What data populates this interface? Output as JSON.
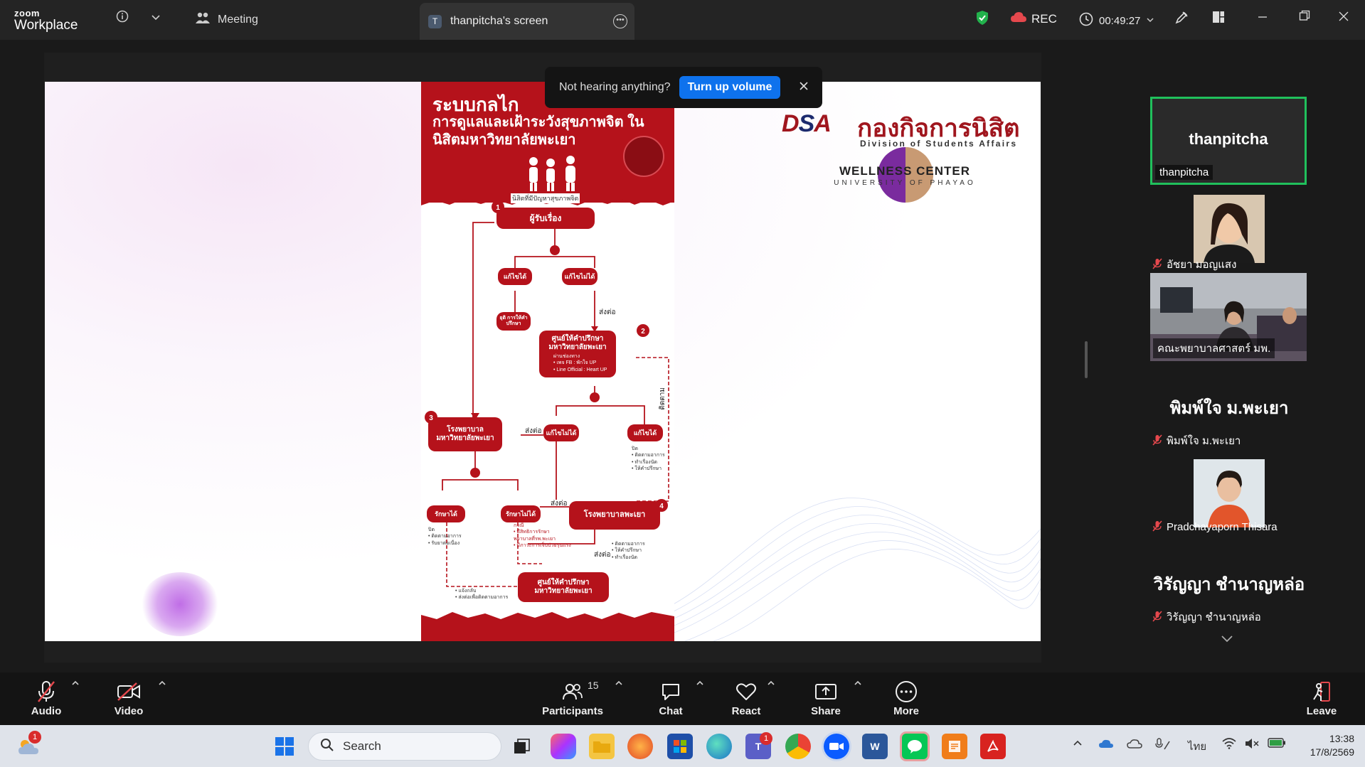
{
  "titlebar": {
    "logo_small": "zoom",
    "logo_big": "Workplace",
    "meeting_label": "Meeting",
    "shared_screen_tab": "thanpitcha's screen",
    "shared_screen_initial": "T",
    "rec_label": "REC",
    "elapsed_time": "00:49:27"
  },
  "toast": {
    "message": "Not hearing anything?",
    "button_label": "Turn up volume"
  },
  "poster": {
    "title_line1": "ระบบกลไก",
    "title_line2": "การดูแลและเฝ้าระวังสุขภาพจิต ในนิสิตมหาวิทยาลัยพะเยา",
    "caption": "นิสิตที่มีปัญหาสุขภาพจิต",
    "nodes": {
      "receiver": "ผู้รับเรื่อง",
      "solved1": "แก้ไขได้",
      "unsolved1": "แก้ไขไม่ได้",
      "close_case1": "ยุติ การให้คำปรึกษา",
      "counsel_center1": "ศูนย์ให้คำปรึกษา มหาวิทยาลัยพะเยา",
      "uni_hospital": "โรงพยาบาล มหาวิทยาลัยพะเยา",
      "unsolved2": "แก้ไขไม่ได้",
      "solved2": "แก้ไขได้",
      "treat_ok": "รักษาได้",
      "treat_fail": "รักษาไม่ได้",
      "phayao_hospital": "โรงพยาบาลพะเยา",
      "counsel_center2": "ศูนย์ให้คำปรึกษา มหาวิทยาลัยพะเยา"
    },
    "flow_labels": {
      "forward1": "ส่งต่อ",
      "forward2": "ส่งต่อ",
      "forward3": "ส่งต่อ",
      "forward4": "ส่งต่อ",
      "follow": "ติดตาม"
    },
    "counsel_bullets": [
      "ผ่านช่องทาง",
      "• เพจ FB : พักใจ UP",
      "• Line Official : Heart UP"
    ],
    "solved2_bullets": [
      "ปิด",
      "• ติดตามอาการ",
      "• ทำเรื่องนัด",
      "• ให้คำปรึกษา"
    ],
    "treat_ok_bullets": [
      "ปิด",
      "• ติดตามอาการ",
      "• รับยาต่อเนื่อง"
    ],
    "treat_fail_bullets": [
      "กรณี",
      "• มีสิทธิการรักษา",
      "  พยาบาลที่รพ.พะเยา",
      "• มีภาวะการเจ็บป่วยรุนแรง"
    ],
    "phayao_bullets": [
      "• ติดตามอาการ",
      "• ให้คำปรึกษา",
      "• ทำเรื่องนัด"
    ],
    "counsel2_bullets": [
      "• แจ้งกลับ",
      "• ส่งต่อเพื่อติดตามอาการ"
    ],
    "step_numbers": [
      "1",
      "2",
      "3",
      "4"
    ]
  },
  "logos": {
    "dsa_mark_d": "D",
    "dsa_mark_s": "S",
    "dsa_mark_a": "A",
    "dsa_thai": "กองกิจการนิสิต",
    "dsa_english": "Division of Students Affairs",
    "wellness_title": "WELLNESS CENTER",
    "wellness_sub": "UNIVERSITY OF PHAYAO"
  },
  "participants": [
    {
      "display": "thanpitcha",
      "name": "thanpitcha",
      "type": "name-card",
      "active": true,
      "muted": false
    },
    {
      "name": "อัชยา มอญแสง",
      "type": "video",
      "muted": true
    },
    {
      "name": "คณะพยาบาลศาสตร์ มพ.",
      "type": "video",
      "muted": true
    },
    {
      "display": "พิมพ์ใจ ม.พะเยา",
      "name": "พิมพ์ใจ ม.พะเยา",
      "type": "name-only",
      "muted": true
    },
    {
      "name": "Pradchayaporn Thisara",
      "type": "video",
      "muted": true
    },
    {
      "display": "วิรัญญา ชำนาญหล่อ",
      "name": "วิรัญญา ชำนาญหล่อ",
      "type": "name-only",
      "muted": true
    }
  ],
  "toolbar": {
    "audio": "Audio",
    "video": "Video",
    "participants": "Participants",
    "participants_count": "15",
    "chat": "Chat",
    "react": "React",
    "share": "Share",
    "more": "More",
    "leave": "Leave"
  },
  "taskbar": {
    "weather_badge": "1",
    "search_label": "Search",
    "teams_badge": "1",
    "lang": "ไทย",
    "time": "13:38",
    "date": "17/8/2569"
  },
  "colors": {
    "accent_blue": "#0e72ed",
    "active_green": "#20c05c",
    "poster_red": "#b5121b",
    "mute_red": "#e5484d"
  }
}
